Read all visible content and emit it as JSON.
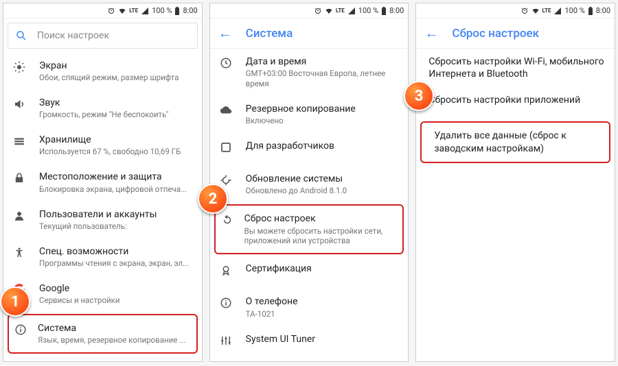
{
  "status": {
    "signal": "LTE",
    "battery_pct": "100 %",
    "time": "8:00"
  },
  "panel1": {
    "search_placeholder": "Поиск настроек",
    "items": [
      {
        "icon": "brightness",
        "title": "Экран",
        "sub": "Обои, спящий режим, размер шрифта"
      },
      {
        "icon": "volume",
        "title": "Звук",
        "sub": "Громкость, режим \"Не беспокоить\""
      },
      {
        "icon": "storage",
        "title": "Хранилище",
        "sub": "Используется 67 %, свободно 10,69 ГБ"
      },
      {
        "icon": "lock",
        "title": "Местоположение и защита",
        "sub": "Блокировка экрана, цифровой отпеча..."
      },
      {
        "icon": "user",
        "title": "Пользователи и аккаунты",
        "sub": "Текущий пользователь: "
      },
      {
        "icon": "a11y",
        "title": "Спец. возможности",
        "sub": "Программы чтения с экрана, экран, эл..."
      },
      {
        "icon": "google",
        "title": "Google",
        "sub": "Сервисы и настройки"
      },
      {
        "icon": "info",
        "title": "Система",
        "sub": "Язык, время, резервное копирование ..."
      }
    ],
    "highlight_index": 7,
    "bubble": "1"
  },
  "panel2": {
    "header": "Система",
    "items": [
      {
        "icon": "clock",
        "title": "Дата и время",
        "sub": "GMT+03:00 Восточная Европа, летнее время"
      },
      {
        "icon": "cloud",
        "title": "Резервное копирование",
        "sub": "Включено"
      },
      {
        "icon": "dev",
        "title": "Для разработчиков",
        "sub": ""
      },
      {
        "icon": "update",
        "title": "Обновление системы",
        "sub": "Обновлено до Android 8.1.0"
      },
      {
        "icon": "reset",
        "title": "Сброс настроек",
        "sub": "Вы можете сбросить настройки сети, приложений или устройства"
      },
      {
        "icon": "cert",
        "title": "Сертификация",
        "sub": ""
      },
      {
        "icon": "info",
        "title": "О телефоне",
        "sub": "TA-1021"
      },
      {
        "icon": "tuner",
        "title": "System UI Tuner",
        "sub": ""
      }
    ],
    "highlight_index": 4,
    "bubble": "2"
  },
  "panel3": {
    "header": "Сброс настроек",
    "items": [
      {
        "title": "Сбросить настройки Wi-Fi, мобильного Интернета и Bluetooth"
      },
      {
        "title": "Сбросить настройки приложений"
      },
      {
        "title": "Удалить все данные (сброс к заводским настройкам)"
      }
    ],
    "highlight_index": 2,
    "bubble": "3"
  }
}
